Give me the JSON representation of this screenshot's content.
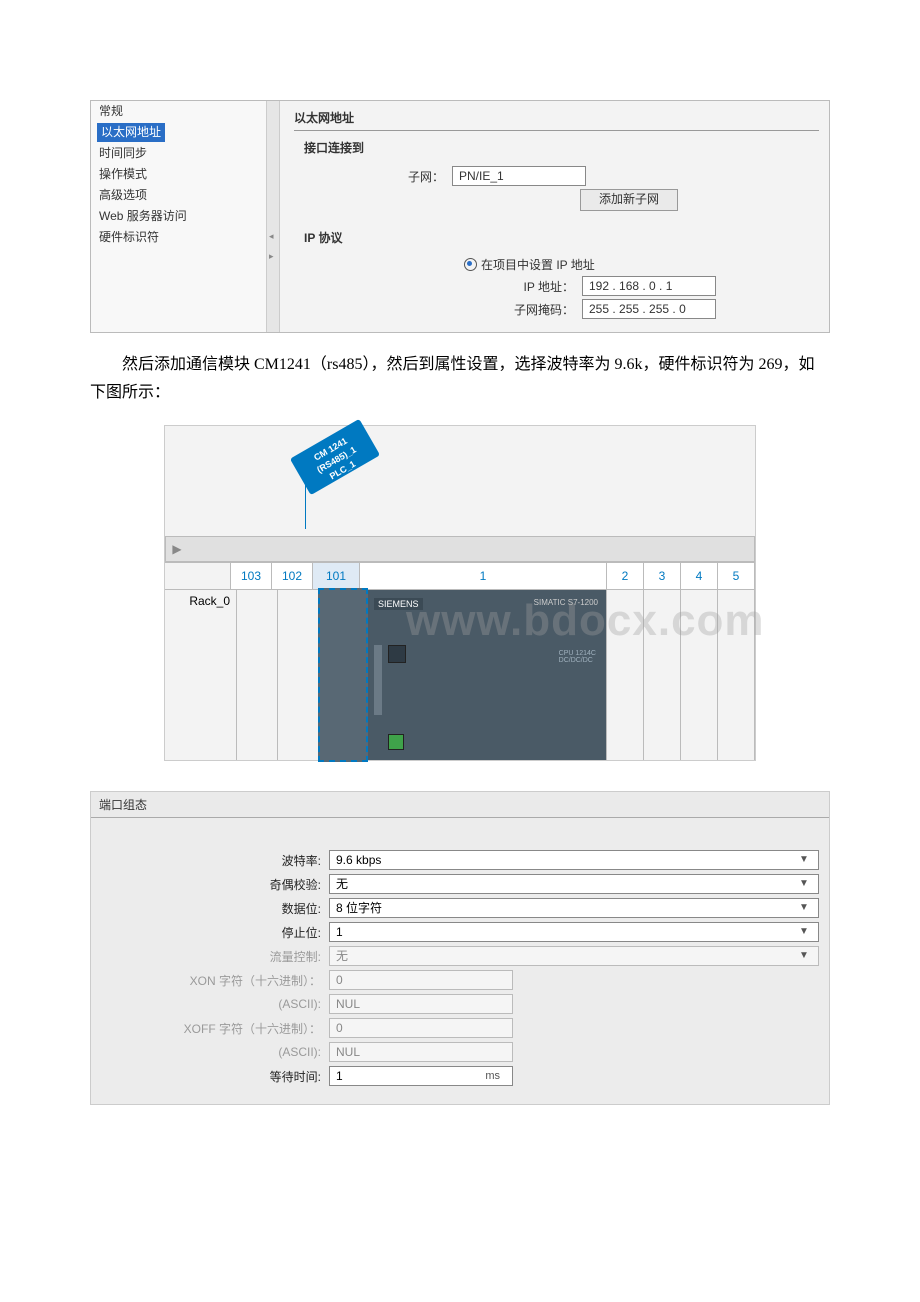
{
  "panel1": {
    "nav": {
      "general": "常规",
      "ethernet_addr": "以太网地址",
      "time_sync": "时间同步",
      "op_mode": "操作模式",
      "adv_opts": "高级选项",
      "web_access": "Web 服务器访问",
      "hw_id": "硬件标识符"
    },
    "section_title": "以太网地址",
    "interface_title": "接口连接到",
    "subnet_label": "子网：",
    "subnet_value": "PN/IE_1",
    "add_subnet_btn": "添加新子网",
    "ip_section": "IP 协议",
    "set_ip_radio": "在项目中设置 IP 地址",
    "ip_label": "IP 地址：",
    "ip_value": "192 . 168 . 0     . 1",
    "mask_label": "子网掩码：",
    "mask_value": "255 . 255 . 255 . 0"
  },
  "body_text": "然后添加通信模块 CM1241（rs485），然后到属性设置，选择波特率为 9.6k，硬件标识符为 269，如下图所示：",
  "panel2": {
    "tag1": "CM 1241 (RS485)_1",
    "tag2": "PLC_1",
    "rack_label": "Rack_0",
    "slots": [
      "103",
      "102",
      "101",
      "1",
      "2",
      "3",
      "4",
      "5"
    ],
    "plc_brand": "SIEMENS",
    "plc_model": "SIMATIC S7-1200",
    "watermark": "www.bdocx.com"
  },
  "panel3": {
    "header": "端口组态",
    "rows": {
      "baud": {
        "label": "波特率:",
        "value": "9.6 kbps"
      },
      "parity": {
        "label": "奇偶校验:",
        "value": "无"
      },
      "data": {
        "label": "数据位:",
        "value": "8 位字符"
      },
      "stop": {
        "label": "停止位:",
        "value": "1"
      },
      "flow": {
        "label": "流量控制:",
        "value": "无"
      },
      "xonhex": {
        "label": "XON 字符（十六进制）：",
        "value": "0"
      },
      "xonasc": {
        "label": "(ASCII):",
        "value": "NUL"
      },
      "xoffhex": {
        "label": "XOFF 字符（十六进制）：",
        "value": "0"
      },
      "xoffasc": {
        "label": "(ASCII):",
        "value": "NUL"
      },
      "wait": {
        "label": "等待时间:",
        "value": "1",
        "unit": "ms"
      }
    }
  }
}
